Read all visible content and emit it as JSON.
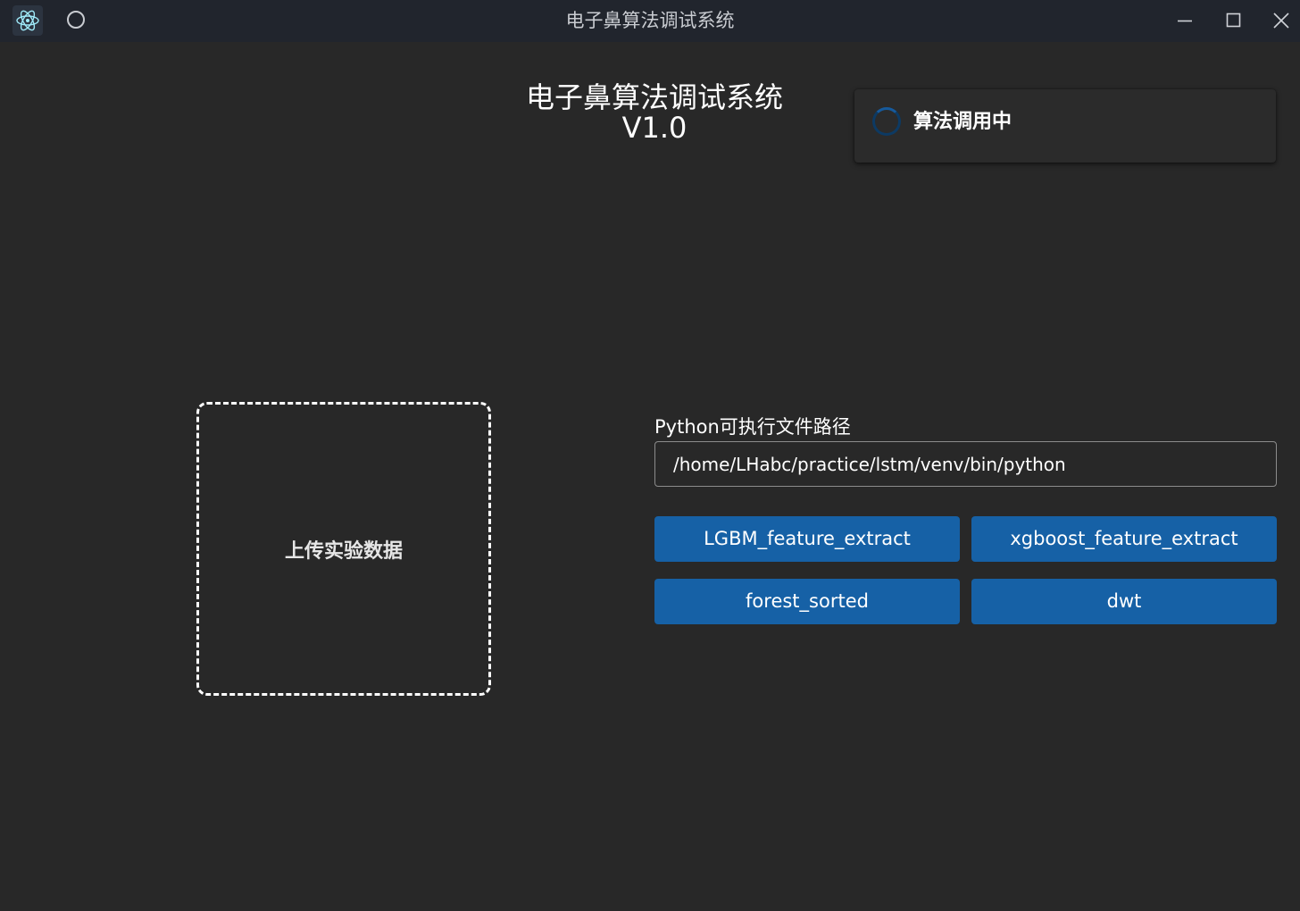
{
  "window": {
    "title": "电子鼻算法调试系统",
    "logo_icon": "electron-atom-icon",
    "status_icon": "circle-icon",
    "controls": [
      "minimize-icon",
      "maximize-icon",
      "close-icon"
    ]
  },
  "header": {
    "title_line1": "电子鼻算法调试系统",
    "title_line2": "V1.0"
  },
  "status": {
    "text": "算法调用中",
    "icon": "spinner-icon",
    "spinner_color": "#165a9c"
  },
  "upload": {
    "label": "上传实验数据"
  },
  "python_path": {
    "label": "Python可执行文件路径",
    "value": "/home/LHabc/practice/lstm/venv/bin/python"
  },
  "algorithms": {
    "lgbm": "LGBM_feature_extract",
    "xgboost": "xgboost_feature_extract",
    "forest": "forest_sorted",
    "dwt": "dwt"
  },
  "colors": {
    "background": "#282828",
    "titlebar": "#21252d",
    "accent": "#1661a6"
  }
}
